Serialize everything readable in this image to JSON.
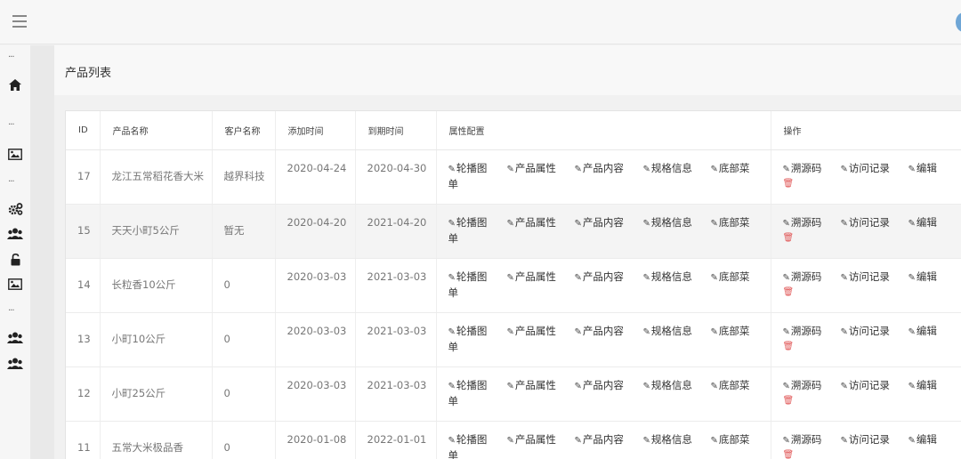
{
  "page": {
    "title": "产品列表"
  },
  "icons": {
    "menu": "hamburger-icon",
    "home": "home-icon",
    "image": "image-icon",
    "settings": "gears-icon",
    "users": "users-icon",
    "unlock": "unlock-icon"
  },
  "sidebar": {
    "dots": "···"
  },
  "table": {
    "headers": [
      "ID",
      "产品名称",
      "客户名称",
      "添加时间",
      "到期时间",
      "属性配置",
      "操作"
    ],
    "attr_actions": [
      "轮播图单",
      "产品属性",
      "产品内容",
      "规格信息",
      "底部菜"
    ],
    "row_actions": [
      "溯源码",
      "访问记录",
      "编辑"
    ],
    "rows": [
      {
        "id": "17",
        "name": "龙江五常稻花香大米",
        "customer": "越界科技",
        "added": "2020-04-24",
        "expires": "2020-04-30"
      },
      {
        "id": "15",
        "name": "天天小町5公斤",
        "customer": "暂无",
        "added": "2020-04-20",
        "expires": "2021-04-20"
      },
      {
        "id": "14",
        "name": "长粒香10公斤",
        "customer": "0",
        "added": "2020-03-03",
        "expires": "2021-03-03"
      },
      {
        "id": "13",
        "name": "小町10公斤",
        "customer": "0",
        "added": "2020-03-03",
        "expires": "2021-03-03"
      },
      {
        "id": "12",
        "name": "小町25公斤",
        "customer": "0",
        "added": "2020-03-03",
        "expires": "2021-03-03"
      },
      {
        "id": "11",
        "name": "五常大米极品香",
        "customer": "0",
        "added": "2020-01-08",
        "expires": "2022-01-01"
      }
    ]
  }
}
